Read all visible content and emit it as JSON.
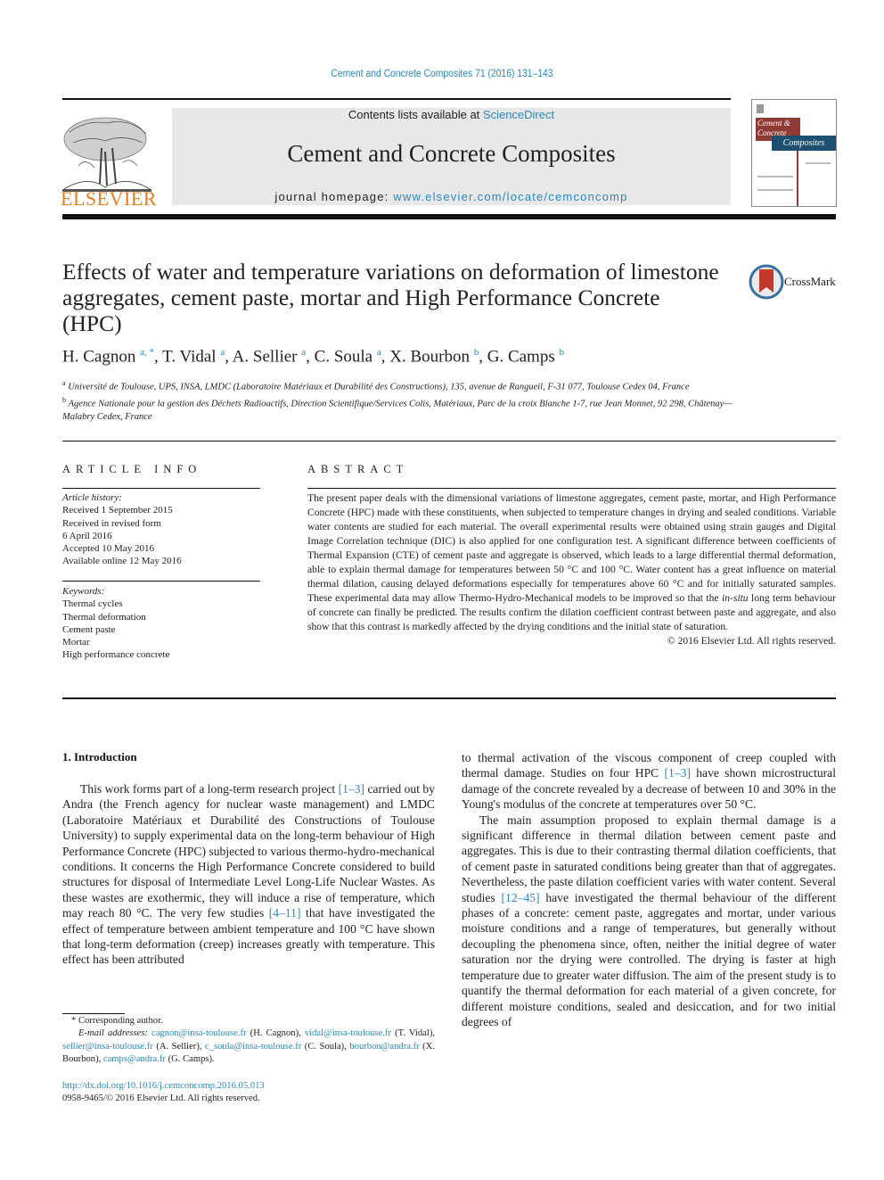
{
  "header": {
    "journal_ref": "Cement and Concrete Composites 71 (2016) 131–143",
    "contents_prefix": "Contents lists available at ",
    "contents_link": "ScienceDirect",
    "journal_title": "Cement and Concrete Composites",
    "homepage_prefix": "journal homepage: ",
    "homepage_link": "www.elsevier.com/locate/cemconcomp",
    "publisher_logo_text": "ELSEVIER",
    "cover": {
      "line1": "Cement &",
      "line2": "Concrete",
      "line3": "Composites"
    },
    "colors": {
      "link": "#2a88c0",
      "elsevier_orange": "#e67e1c",
      "cover_red": "#8e3b36",
      "cover_blue": "#1d4f6e"
    }
  },
  "article": {
    "title": "Effects of water and temperature variations on deformation of limestone aggregates, cement paste, mortar and High Performance Concrete (HPC)",
    "crossmark_label": "CrossMark",
    "authors": [
      {
        "name": "H. Cagnon",
        "sup": "a, *"
      },
      {
        "name": "T. Vidal",
        "sup": "a"
      },
      {
        "name": "A. Sellier",
        "sup": "a"
      },
      {
        "name": "C. Soula",
        "sup": "a"
      },
      {
        "name": "X. Bourbon",
        "sup": "b"
      },
      {
        "name": "G. Camps",
        "sup": "b"
      }
    ],
    "affiliations": [
      {
        "sup": "a",
        "text": "Université de Toulouse, UPS, INSA, LMDC (Laboratoire Matériaux et Durabilité des Constructions), 135, avenue de Rangueil, F-31 077, Toulouse Cedex 04, France"
      },
      {
        "sup": "b",
        "text": "Agence Nationale pour la gestion des Déchets Radioactifs, Direction Scientifique/Services Colis, Matériaux, Parc de la croix Blanche 1-7, rue Jean Monnet, 92 298, Châtenay—Malabry Cedex, France"
      }
    ]
  },
  "article_info": {
    "heading": "ARTICLE INFO",
    "history_label": "Article history:",
    "history": [
      "Received 1 September 2015",
      "Received in revised form",
      "6 April 2016",
      "Accepted 10 May 2016",
      "Available online 12 May 2016"
    ],
    "keywords_label": "Keywords:",
    "keywords": [
      "Thermal cycles",
      "Thermal deformation",
      "Cement paste",
      "Mortar",
      "High performance concrete"
    ]
  },
  "abstract": {
    "heading": "ABSTRACT",
    "text_before_italic": "The present paper deals with the dimensional variations of limestone aggregates, cement paste, mortar, and High Performance Concrete (HPC) made with these constituents, when subjected to temperature changes in drying and sealed conditions. Variable water contents are studied for each material. The overall experimental results were obtained using strain gauges and Digital Image Correlation technique (DIC) is also applied for one configuration test. A significant difference between coefficients of Thermal Expansion (CTE) of cement paste and aggregate is observed, which leads to a large differential thermal deformation, able to explain thermal damage for temperatures between 50 °C and 100 °C. Water content has a great influence on material thermal dilation, causing delayed deformations especially for temperatures above 60 °C and for initially saturated samples. These experimental data may allow Thermo-Hydro-Mechanical models to be improved so that the ",
    "italic": "in-situ",
    "text_after_italic": " long term behaviour of concrete can finally be predicted. The results confirm the dilation coefficient contrast between paste and aggregate, and also show that this contrast is markedly affected by the drying conditions and the initial state of saturation.",
    "copyright": "© 2016 Elsevier Ltd. All rights reserved."
  },
  "body": {
    "section_heading": "1.  Introduction",
    "left": {
      "p1_a": "This work forms part of a long-term research project ",
      "ref1": "[1–3]",
      "p1_b": " carried out by Andra (the French agency for nuclear waste management) and LMDC (Laboratoire Matériaux et Durabilité des Constructions of Toulouse University) to supply experimental data on the long-term behaviour of High Performance Concrete (HPC) subjected to various thermo-hydro-mechanical conditions. It concerns the High Performance Concrete considered to build structures for disposal of Intermediate Level Long-Life Nuclear Wastes. As these wastes are exothermic, they will induce a rise of temperature, which may reach 80 °C. The very few studies ",
      "ref2": "[4–11]",
      "p1_c": " that have investigated the effect of temperature between ambient temperature and 100 °C have shown that long-term deformation (creep) increases greatly with temperature. This effect has been attributed"
    },
    "right": {
      "p1_a": "to thermal activation of the viscous component of creep coupled with thermal damage. Studies on four HPC ",
      "ref1": "[1–3]",
      "p1_b": " have shown microstructural damage of the concrete revealed by a decrease of between 10 and 30% in the Young's modulus of the concrete at temperatures over 50 °C.",
      "p2_a": "The main assumption proposed to explain thermal damage is a significant difference in thermal dilation between cement paste and aggregates. This is due to their contrasting thermal dilation coefficients, that of cement paste in saturated conditions being greater than that of aggregates. Nevertheless, the paste dilation coefficient varies with water content. Several studies ",
      "ref2": "[12–45]",
      "p2_b": " have investigated the thermal behaviour of the different phases of a concrete: cement paste, aggregates and mortar, under various moisture conditions and a range of temperatures, but generally without decoupling the phenomena since, often, neither the initial degree of water saturation nor the drying were controlled. The drying is faster at high temperature due to greater water diffusion. The aim of the present study is to quantify the thermal deformation for each material of a given concrete, for different moisture conditions, sealed and desiccation, and for two initial degrees of"
    }
  },
  "footnotes": {
    "corresponding": "* Corresponding author.",
    "email_label": "E-mail addresses:",
    "emails": [
      {
        "addr": "cagnon@insa-toulouse.fr",
        "name": " (H. Cagnon), "
      },
      {
        "addr": "vidal@insa-toulouse.fr",
        "name": " (T. Vidal), "
      },
      {
        "addr": "sellier@insa-toulouse.fr",
        "name": " (A. Sellier), "
      },
      {
        "addr": "c_soula@insa-toulouse.fr",
        "name": " (C. Soula), "
      },
      {
        "addr": "bourbon@andra.fr",
        "name": " (X. Bourbon), "
      },
      {
        "addr": "camps@andra.fr",
        "name": " (G. Camps)."
      }
    ],
    "doi": "http://dx.doi.org/10.1016/j.cemconcomp.2016.05.013",
    "issn_line": "0958-9465/© 2016 Elsevier Ltd. All rights reserved."
  }
}
